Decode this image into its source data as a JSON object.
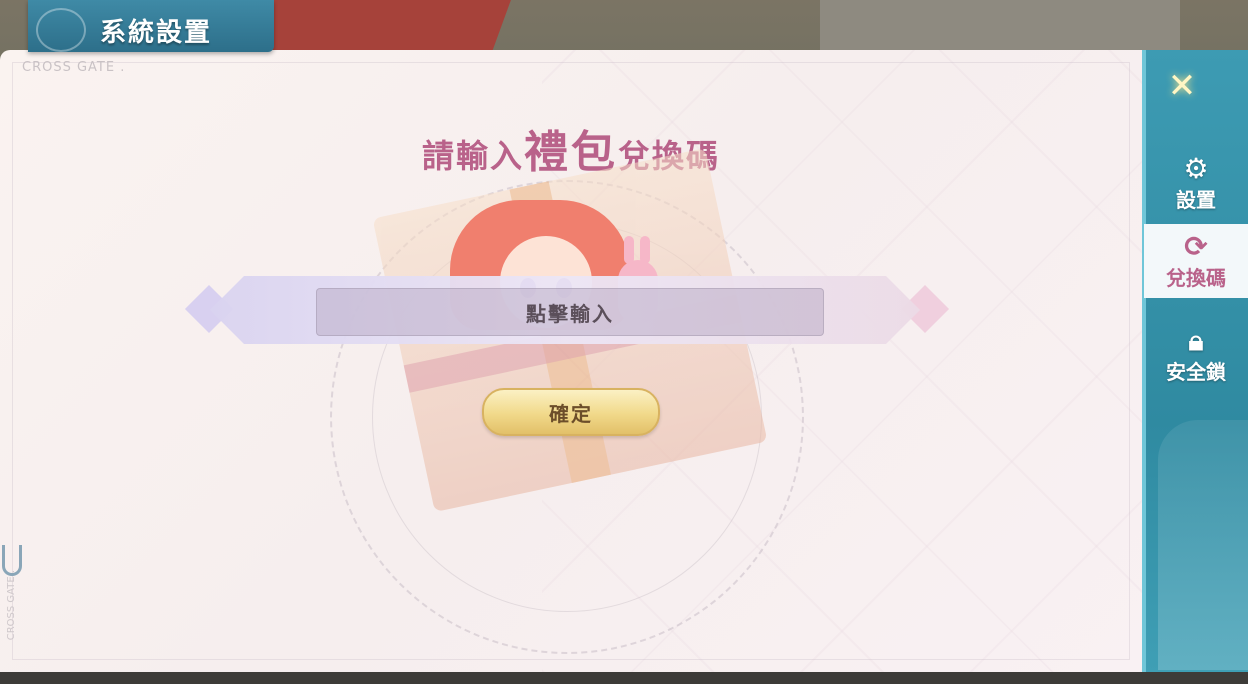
{
  "header": {
    "title": "系統設置"
  },
  "watermark": {
    "text": "CROSS GATE .",
    "vertical_text": "CROSS GATE ."
  },
  "redeem": {
    "heading_prefix": "請輸入",
    "heading_emphasis": "禮包",
    "heading_suffix": "兌換碼",
    "input_placeholder": "點擊輸入",
    "confirm_label": "確定"
  },
  "sidebar": {
    "close_icon": "close-x-icon",
    "items": [
      {
        "label": "設置",
        "icon": "gear-icon",
        "active": false
      },
      {
        "label": "兌換碼",
        "icon": "redeem-icon",
        "active": true
      },
      {
        "label": "安全鎖",
        "icon": "lock-icon",
        "active": false
      }
    ]
  },
  "colors": {
    "accent_pink": "#b9628a",
    "sidebar_teal": "#2f8aa1",
    "confirm_gold": "#f1d98a"
  }
}
